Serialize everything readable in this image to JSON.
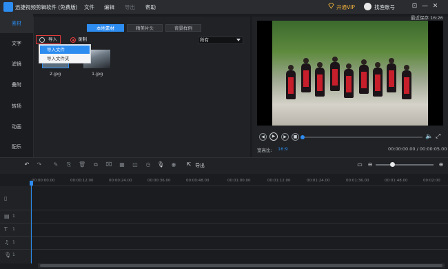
{
  "app": {
    "title": "迅捷视频剪辑软件 (免费版)",
    "menus": [
      "文件",
      "编辑",
      "导出",
      "帮助"
    ],
    "vip_label": "开通VIP",
    "user_name": "找渔账号",
    "window_controls": [
      "⊡",
      "—",
      "✕"
    ]
  },
  "leftnav": {
    "items": [
      {
        "label": "素材"
      },
      {
        "label": "文字"
      },
      {
        "label": "滤镜"
      },
      {
        "label": "叠附"
      },
      {
        "label": "转场"
      },
      {
        "label": "动画"
      },
      {
        "label": "配乐"
      }
    ]
  },
  "media": {
    "tabs": [
      "本地素材",
      "精美片头",
      "背景样例"
    ],
    "import_label": "导入",
    "record_label": "录制",
    "filter_value": "所有",
    "dropdown": [
      "导入文件",
      "导入文件夹"
    ],
    "thumbs": [
      {
        "label": "2.jpg"
      },
      {
        "label": "1.jpg"
      }
    ]
  },
  "preview": {
    "save_time": "最近保存 16:26",
    "aspect_label": "宽高比:",
    "aspect_value": "16:9",
    "time": "00:00:00.00 / 00:00:05.00",
    "progress": 0.0
  },
  "timeline": {
    "export_label": "导出",
    "ticks": [
      "00:00:00.00",
      "00:00:12.00",
      "00:00:24.00",
      "00:00:36.00",
      "00:00:48.00",
      "00:01:00.00",
      "00:01:12.00",
      "00:01:24.00",
      "00:01:36.00",
      "00:01:48.00",
      "00:02:00"
    ],
    "tracks": [
      {
        "num": ""
      },
      {
        "num": "1"
      },
      {
        "num": "1"
      },
      {
        "num": "1"
      },
      {
        "num": "1"
      }
    ]
  },
  "colors": {
    "accent": "#2d8cf0",
    "highlight_border": "#e23b3b",
    "vip": "#f2b23c"
  }
}
